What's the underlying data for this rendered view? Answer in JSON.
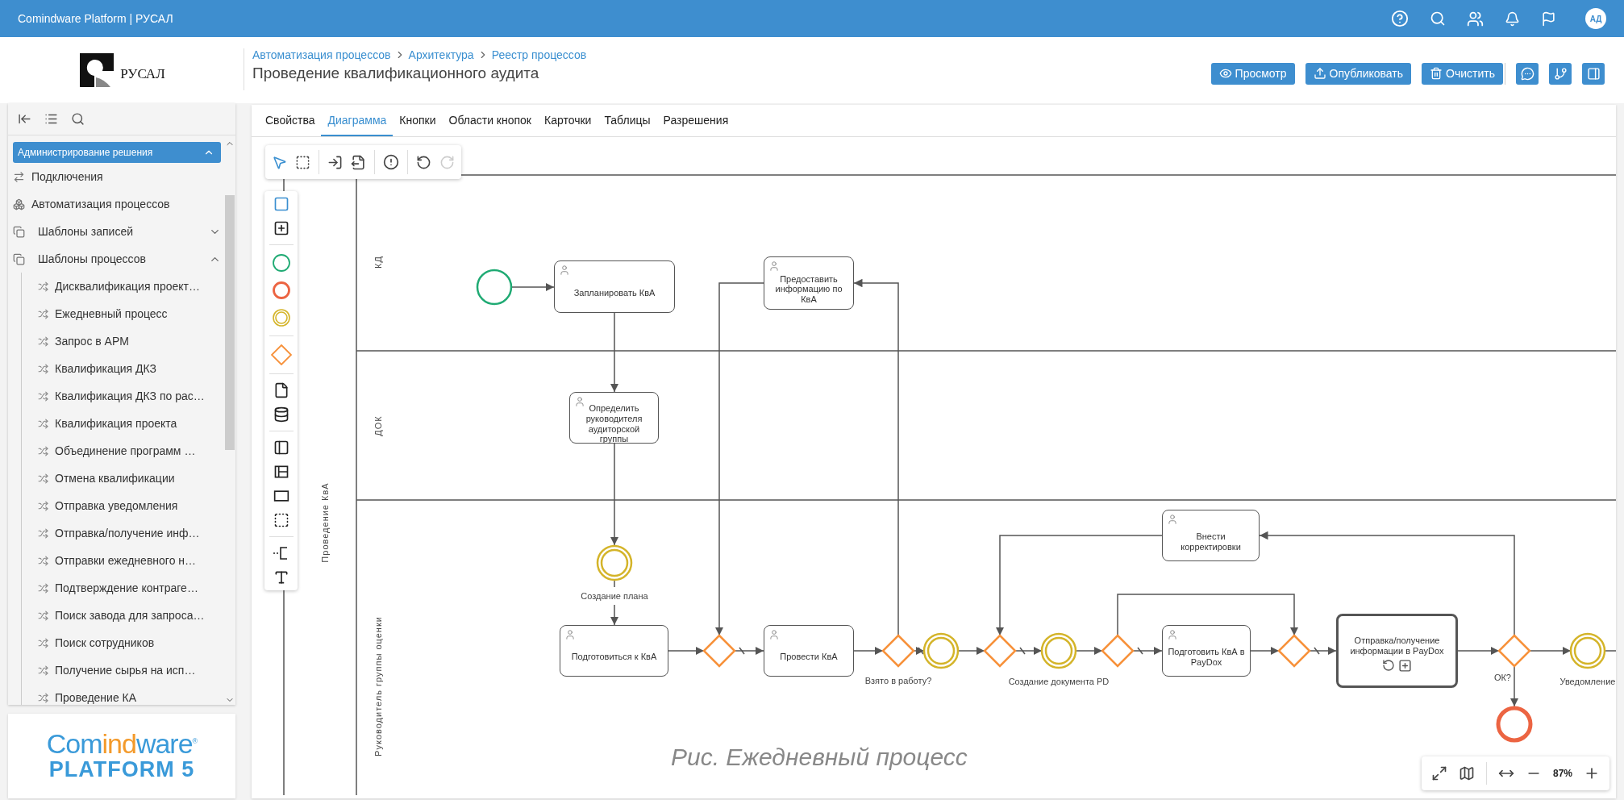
{
  "app_bar": {
    "title": "Comindware Platform | РУСАЛ",
    "avatar": "АД"
  },
  "header": {
    "logo_text": "РУСАЛ",
    "breadcrumbs": [
      "Автоматизация процессов",
      "Архитектура",
      "Реестр процессов"
    ],
    "title": "Проведение квалификационного аудита",
    "actions": [
      {
        "label": "Просмотр",
        "kind": "view"
      },
      {
        "label": "Опубликовать",
        "kind": "publish"
      },
      {
        "label": "Очистить",
        "kind": "clear"
      }
    ]
  },
  "sidebar": {
    "section": {
      "label": "Администрирование решения",
      "expanded": true
    },
    "items": [
      {
        "label": "Подключения",
        "kind": "connections"
      },
      {
        "label": "Автоматизация процессов",
        "kind": "automation"
      },
      {
        "label": "Шаблоны записей",
        "kind": "folder",
        "expanded": false
      },
      {
        "label": "Шаблоны процессов",
        "kind": "folder",
        "expanded": true,
        "children": [
          {
            "label": "Дисквалификация проект…"
          },
          {
            "label": "Ежедневный процесс"
          },
          {
            "label": "Запрос в АРМ"
          },
          {
            "label": "Квалификация ДКЗ"
          },
          {
            "label": "Квалификация ДКЗ по рас…"
          },
          {
            "label": "Квалификация проекта"
          },
          {
            "label": "Объединение программ …"
          },
          {
            "label": "Отмена квалификации"
          },
          {
            "label": "Отправка уведомления"
          },
          {
            "label": "Отправка/получение инф…"
          },
          {
            "label": "Отправки ежедневного н…"
          },
          {
            "label": "Подтверждение контраге…"
          },
          {
            "label": "Поиск завода для запроса…"
          },
          {
            "label": "Поиск сотрудников"
          },
          {
            "label": "Получение сырья на исп…"
          },
          {
            "label": "Проведение КА"
          }
        ]
      }
    ]
  },
  "brand": {
    "wordmark": [
      "Com",
      "ind",
      "ware"
    ],
    "registered": "®",
    "product": "PLATFORM 5"
  },
  "tabs": [
    {
      "label": "Свойства",
      "selected": false
    },
    {
      "label": "Диаграмма",
      "selected": true
    },
    {
      "label": "Кнопки",
      "selected": false
    },
    {
      "label": "Области кнопок",
      "selected": false
    },
    {
      "label": "Карточки",
      "selected": false
    },
    {
      "label": "Таблицы",
      "selected": false
    },
    {
      "label": "Разрешения",
      "selected": false
    }
  ],
  "toolbar": {
    "undo": {
      "disabled": false
    },
    "redo": {
      "disabled": true
    }
  },
  "diagram": {
    "pool": "Проведение КвА",
    "lanes": [
      "КД",
      "ДОК",
      "Руководитель группы оценки"
    ],
    "nodes": [
      {
        "kind": "start"
      },
      {
        "kind": "task",
        "label": "Запланировать КвА"
      },
      {
        "kind": "task",
        "label": "Предоставить информацию по КвА"
      },
      {
        "kind": "task",
        "label": "Определить руководителя аудиторской группы"
      },
      {
        "kind": "intermediate",
        "label": "Создание плана"
      },
      {
        "kind": "task",
        "label": "Подготовиться к КвА"
      },
      {
        "kind": "gateway"
      },
      {
        "kind": "task",
        "label": "Провести КвА"
      },
      {
        "kind": "gateway",
        "label": "Взято в работу?"
      },
      {
        "kind": "intermediate"
      },
      {
        "kind": "gateway"
      },
      {
        "kind": "intermediate",
        "label": "Создание документа PD"
      },
      {
        "kind": "gateway"
      },
      {
        "kind": "task",
        "label": "Подготовить КвА в PayDox"
      },
      {
        "kind": "gateway"
      },
      {
        "kind": "subprocess",
        "label": "Отправка/получение информации в PayDox"
      },
      {
        "kind": "gateway",
        "label": "ОК?"
      },
      {
        "kind": "intermediate",
        "label": "Уведомление"
      },
      {
        "kind": "end"
      },
      {
        "kind": "task",
        "label": "Внести корректировки"
      }
    ]
  },
  "caption": "Рис. Ежедневный процесс",
  "zoom": {
    "value": "87%"
  }
}
